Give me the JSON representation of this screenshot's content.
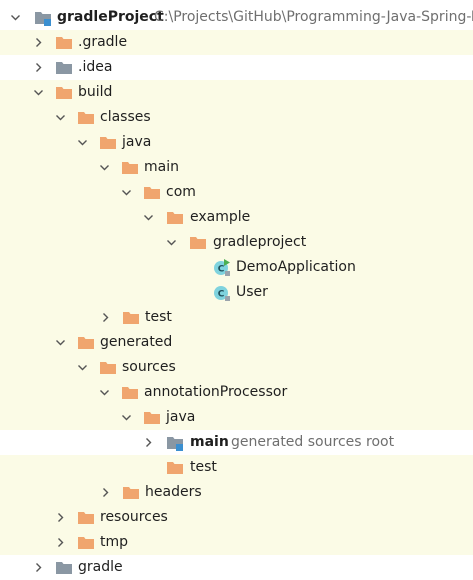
{
  "tree": {
    "project": {
      "name": "gradleProject",
      "path": "C:\\Projects\\GitHub\\Programming-Java-Spring-B"
    },
    "items": [
      {
        "label": ".gradle"
      },
      {
        "label": ".idea"
      },
      {
        "label": "build"
      },
      {
        "label": "classes"
      },
      {
        "label": "java"
      },
      {
        "label": "main"
      },
      {
        "label": "com"
      },
      {
        "label": "example"
      },
      {
        "label": "gradleproject"
      },
      {
        "label": "DemoApplication"
      },
      {
        "label": "User"
      },
      {
        "label": "test"
      },
      {
        "label": "generated"
      },
      {
        "label": "sources"
      },
      {
        "label": "annotationProcessor"
      },
      {
        "label": "java"
      },
      {
        "label": "main",
        "hint": "generated sources root"
      },
      {
        "label": "test"
      },
      {
        "label": "headers"
      },
      {
        "label": "resources"
      },
      {
        "label": "tmp"
      },
      {
        "label": "gradle"
      }
    ]
  },
  "colors": {
    "folder": "#f0a56e",
    "folder_gray": "#8a97a3",
    "highlight_bg": "#fbfbe6",
    "class_icon_bg": "#7fd3de",
    "run_marker": "#4caf50",
    "source_root_blue": "#3b8fd0"
  }
}
